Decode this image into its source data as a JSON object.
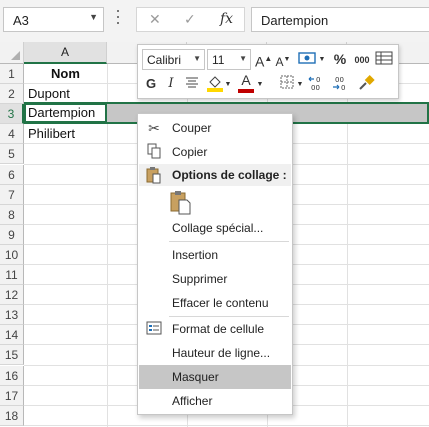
{
  "formula_bar": {
    "name_box": "A3",
    "cancel_glyph": "✕",
    "enter_glyph": "✓",
    "fx_label": "fx",
    "content": "Dartempion"
  },
  "columns": [
    "A"
  ],
  "rows": [
    "1",
    "2",
    "3",
    "4",
    "5",
    "6",
    "7",
    "8",
    "9",
    "10",
    "11",
    "12",
    "13",
    "14",
    "15",
    "16",
    "17",
    "18"
  ],
  "cells": {
    "A1": "Nom",
    "A2": "Dupont",
    "A3": "Dartempion",
    "A4": "Philibert"
  },
  "mini_toolbar": {
    "font_name": "Calibri",
    "font_size": "11",
    "grow_font": "A",
    "shrink_font": "A",
    "percent": "%",
    "thousands": "000",
    "bold": "G",
    "italic": "I",
    "font_color_letter": "A",
    "accent_color": "#c00000",
    "fill_color": "#ffd800"
  },
  "context_menu": {
    "items": [
      {
        "label": "Couper",
        "icon": "scissors-icon"
      },
      {
        "label": "Copier",
        "icon": "copy-icon"
      },
      {
        "label": "Options de collage :",
        "icon": "paste-icon"
      },
      {
        "label": "Collage spécial...",
        "icon": ""
      },
      {
        "label": "Insertion",
        "icon": ""
      },
      {
        "label": "Supprimer",
        "icon": ""
      },
      {
        "label": "Effacer le contenu",
        "icon": ""
      },
      {
        "label": "Format de cellule",
        "icon": "format-cells-icon"
      },
      {
        "label": "Hauteur de ligne...",
        "icon": ""
      },
      {
        "label": "Masquer",
        "icon": "",
        "highlighted": true
      },
      {
        "label": "Afficher",
        "icon": ""
      }
    ]
  }
}
